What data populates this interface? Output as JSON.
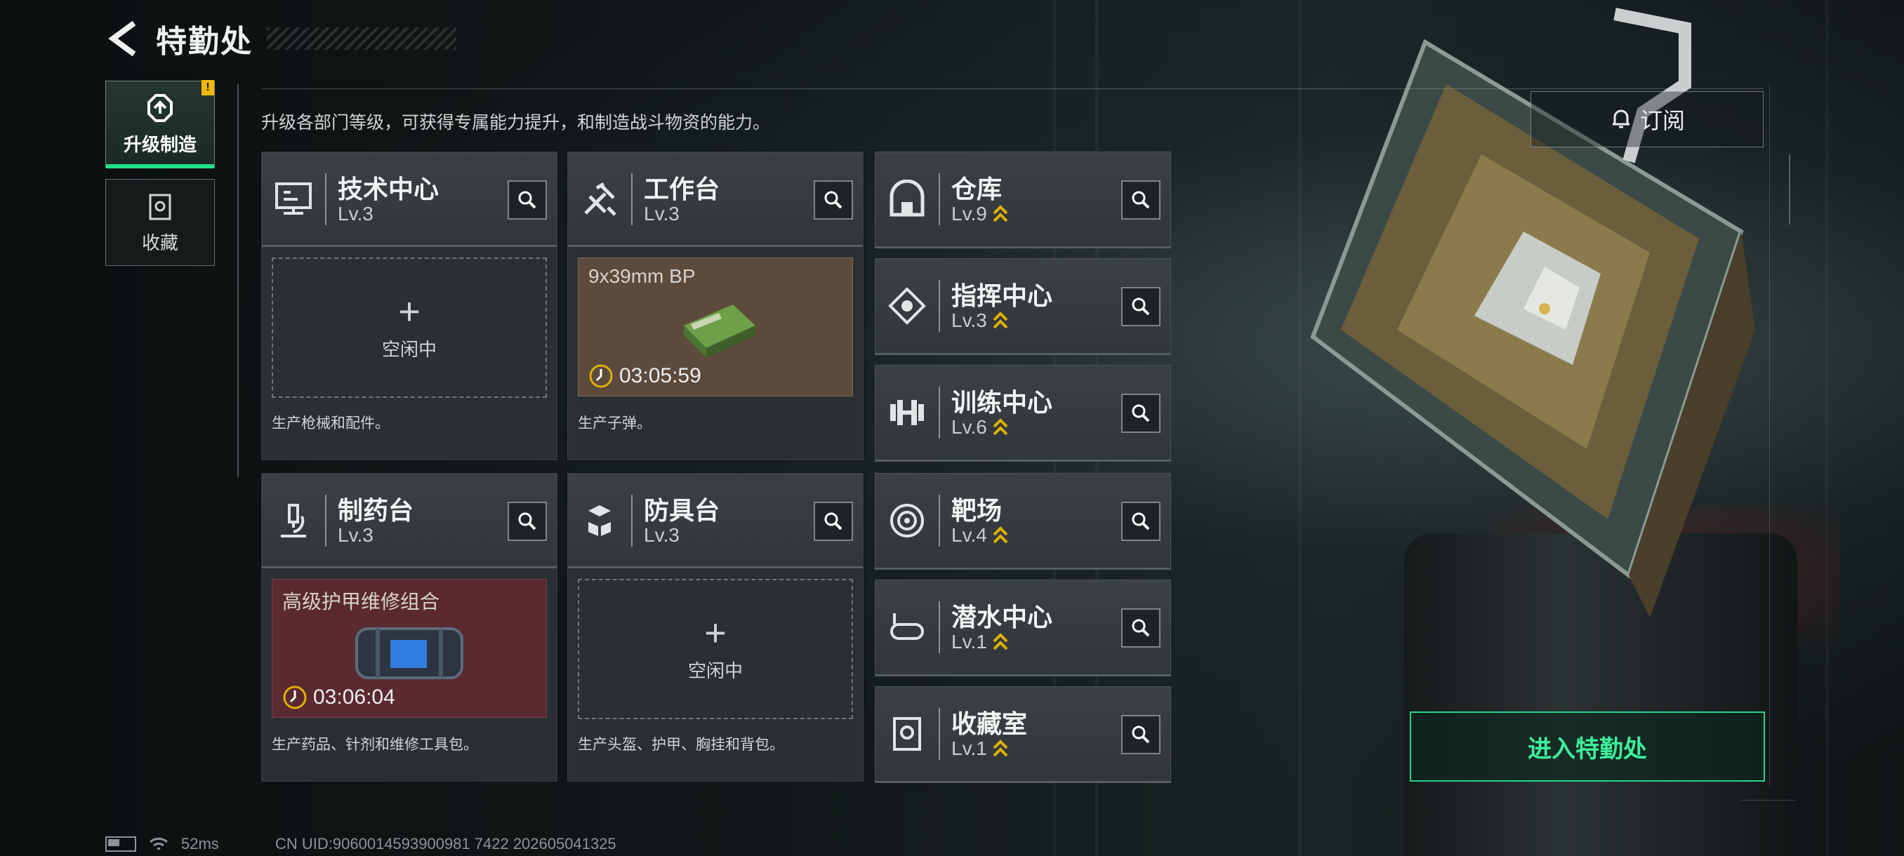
{
  "header": {
    "title": "特勤处"
  },
  "tabs": [
    {
      "label": "升级制造",
      "badge": "!"
    },
    {
      "label": "收藏"
    }
  ],
  "description": "升级各部门等级，可获得专属能力提升，和制造战斗物资的能力。",
  "stations": {
    "tech_center": {
      "name": "技术中心",
      "level": "Lv.3",
      "slot_status": "空闲中",
      "footer": "生产枪械和配件。"
    },
    "workbench": {
      "name": "工作台",
      "level": "Lv.3",
      "item": "9x39mm BP",
      "timer": "03:05:59",
      "footer": "生产子弹。"
    },
    "pharmacy": {
      "name": "制药台",
      "level": "Lv.3",
      "item": "高级护甲维修组合",
      "timer": "03:06:04",
      "footer": "生产药品、针剂和维修工具包。"
    },
    "armor_bench": {
      "name": "防具台",
      "level": "Lv.3",
      "slot_status": "空闲中",
      "footer": "生产头盔、护甲、胸挂和背包。"
    }
  },
  "departments": [
    {
      "name": "仓库",
      "level": "Lv.9",
      "icon": "warehouse-icon"
    },
    {
      "name": "指挥中心",
      "level": "Lv.3",
      "icon": "command-icon"
    },
    {
      "name": "训练中心",
      "level": "Lv.6",
      "icon": "dumbbell-icon"
    },
    {
      "name": "靶场",
      "level": "Lv.4",
      "icon": "target-icon"
    },
    {
      "name": "潜水中心",
      "level": "Lv.1",
      "icon": "diving-icon"
    },
    {
      "name": "收藏室",
      "level": "Lv.1",
      "icon": "collection-icon"
    }
  ],
  "right": {
    "subscribe_label": "订阅",
    "enter_label": "进入特勤处"
  },
  "status": {
    "ping": "52ms",
    "uid": "CN UID:9060014593900981 7422 202605041325"
  },
  "colors": {
    "accent": "#22e08a",
    "upgrade_arrow": "#e0b000"
  }
}
